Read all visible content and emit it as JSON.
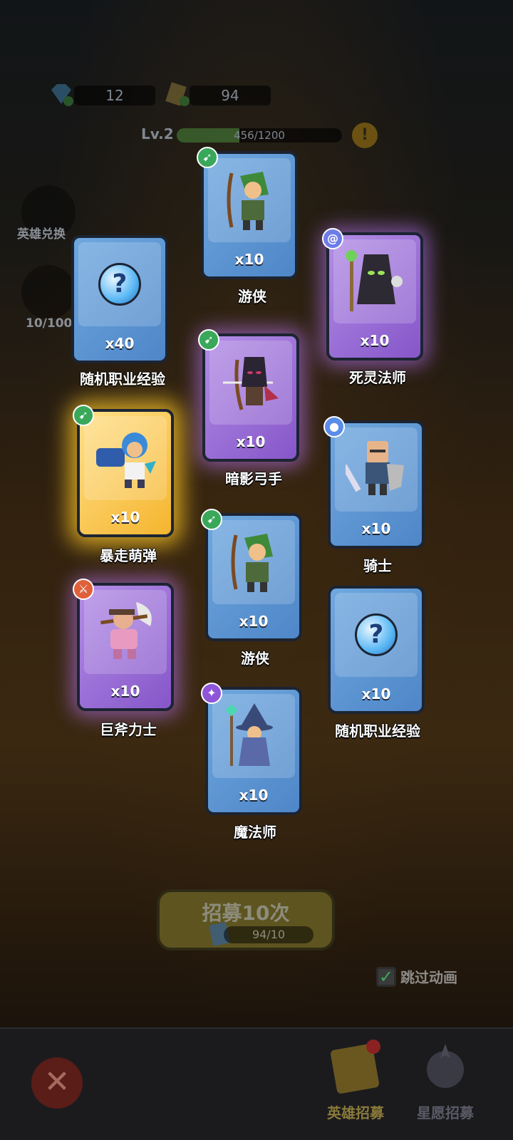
{
  "resources": {
    "gems": "12",
    "tickets": "94"
  },
  "level": {
    "label": "Lv.2",
    "xp_text": "456/1200",
    "xp_progress": 0.38,
    "warning": "!"
  },
  "side": {
    "hero_exchange": "英雄兑换",
    "star_count": "10/100"
  },
  "cards": [
    {
      "name": "游侠",
      "qty": "x10",
      "rarity": "blue",
      "badge": "green",
      "badge_icon": "bow-icon",
      "hero": "ranger"
    },
    {
      "name": "死灵法师",
      "qty": "x10",
      "rarity": "purple",
      "badge": "spiral",
      "badge_icon": "spiral-icon",
      "hero": "necromancer"
    },
    {
      "name": "随机职业经验",
      "qty": "x40",
      "rarity": "blue",
      "badge": "",
      "badge_icon": "",
      "hero": "question"
    },
    {
      "name": "暗影弓手",
      "qty": "x10",
      "rarity": "purple",
      "badge": "green",
      "badge_icon": "bow-icon",
      "hero": "shadow-archer"
    },
    {
      "name": "暴走萌弹",
      "qty": "x10",
      "rarity": "gold",
      "badge": "green",
      "badge_icon": "bow-icon",
      "hero": "gunner"
    },
    {
      "name": "骑士",
      "qty": "x10",
      "rarity": "blue",
      "badge": "paw",
      "badge_icon": "paw-icon",
      "hero": "knight"
    },
    {
      "name": "游侠",
      "qty": "x10",
      "rarity": "blue",
      "badge": "green",
      "badge_icon": "bow-icon",
      "hero": "ranger"
    },
    {
      "name": "巨斧力士",
      "qty": "x10",
      "rarity": "purple",
      "badge": "red",
      "badge_icon": "sword-icon",
      "hero": "axeman"
    },
    {
      "name": "随机职业经验",
      "qty": "x10",
      "rarity": "blue",
      "badge": "",
      "badge_icon": "",
      "hero": "question"
    },
    {
      "name": "魔法师",
      "qty": "x10",
      "rarity": "blue",
      "badge": "purpleb",
      "badge_icon": "wand-icon",
      "hero": "mage"
    }
  ],
  "recruit": {
    "label": "招募10次",
    "cost": "94/10"
  },
  "skip": {
    "label": "跳过动画",
    "checked": true
  },
  "tabs": {
    "hero_recruit": "英雄招募",
    "wish_recruit": "星愿招募"
  },
  "colors": {
    "accent_gold": "#f5b52e",
    "purple_glow": "#b38ee6",
    "blue_card": "#6fa8df"
  }
}
